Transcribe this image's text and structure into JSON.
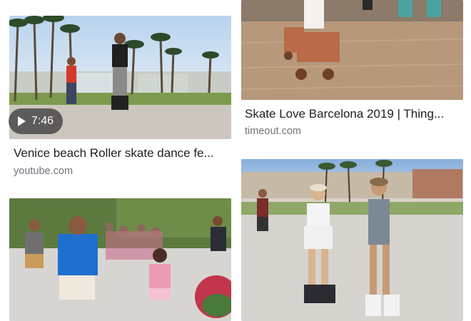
{
  "results": [
    {
      "title": "Venice beach Roller skate dance fe...",
      "source": "youtube.com",
      "duration": "7:46",
      "icon": "play-icon"
    },
    {
      "title": "Skate Love Barcelona 2019 | Thing...",
      "source": "timeout.com"
    },
    {
      "title": "",
      "source": ""
    },
    {
      "title": "",
      "source": ""
    }
  ]
}
